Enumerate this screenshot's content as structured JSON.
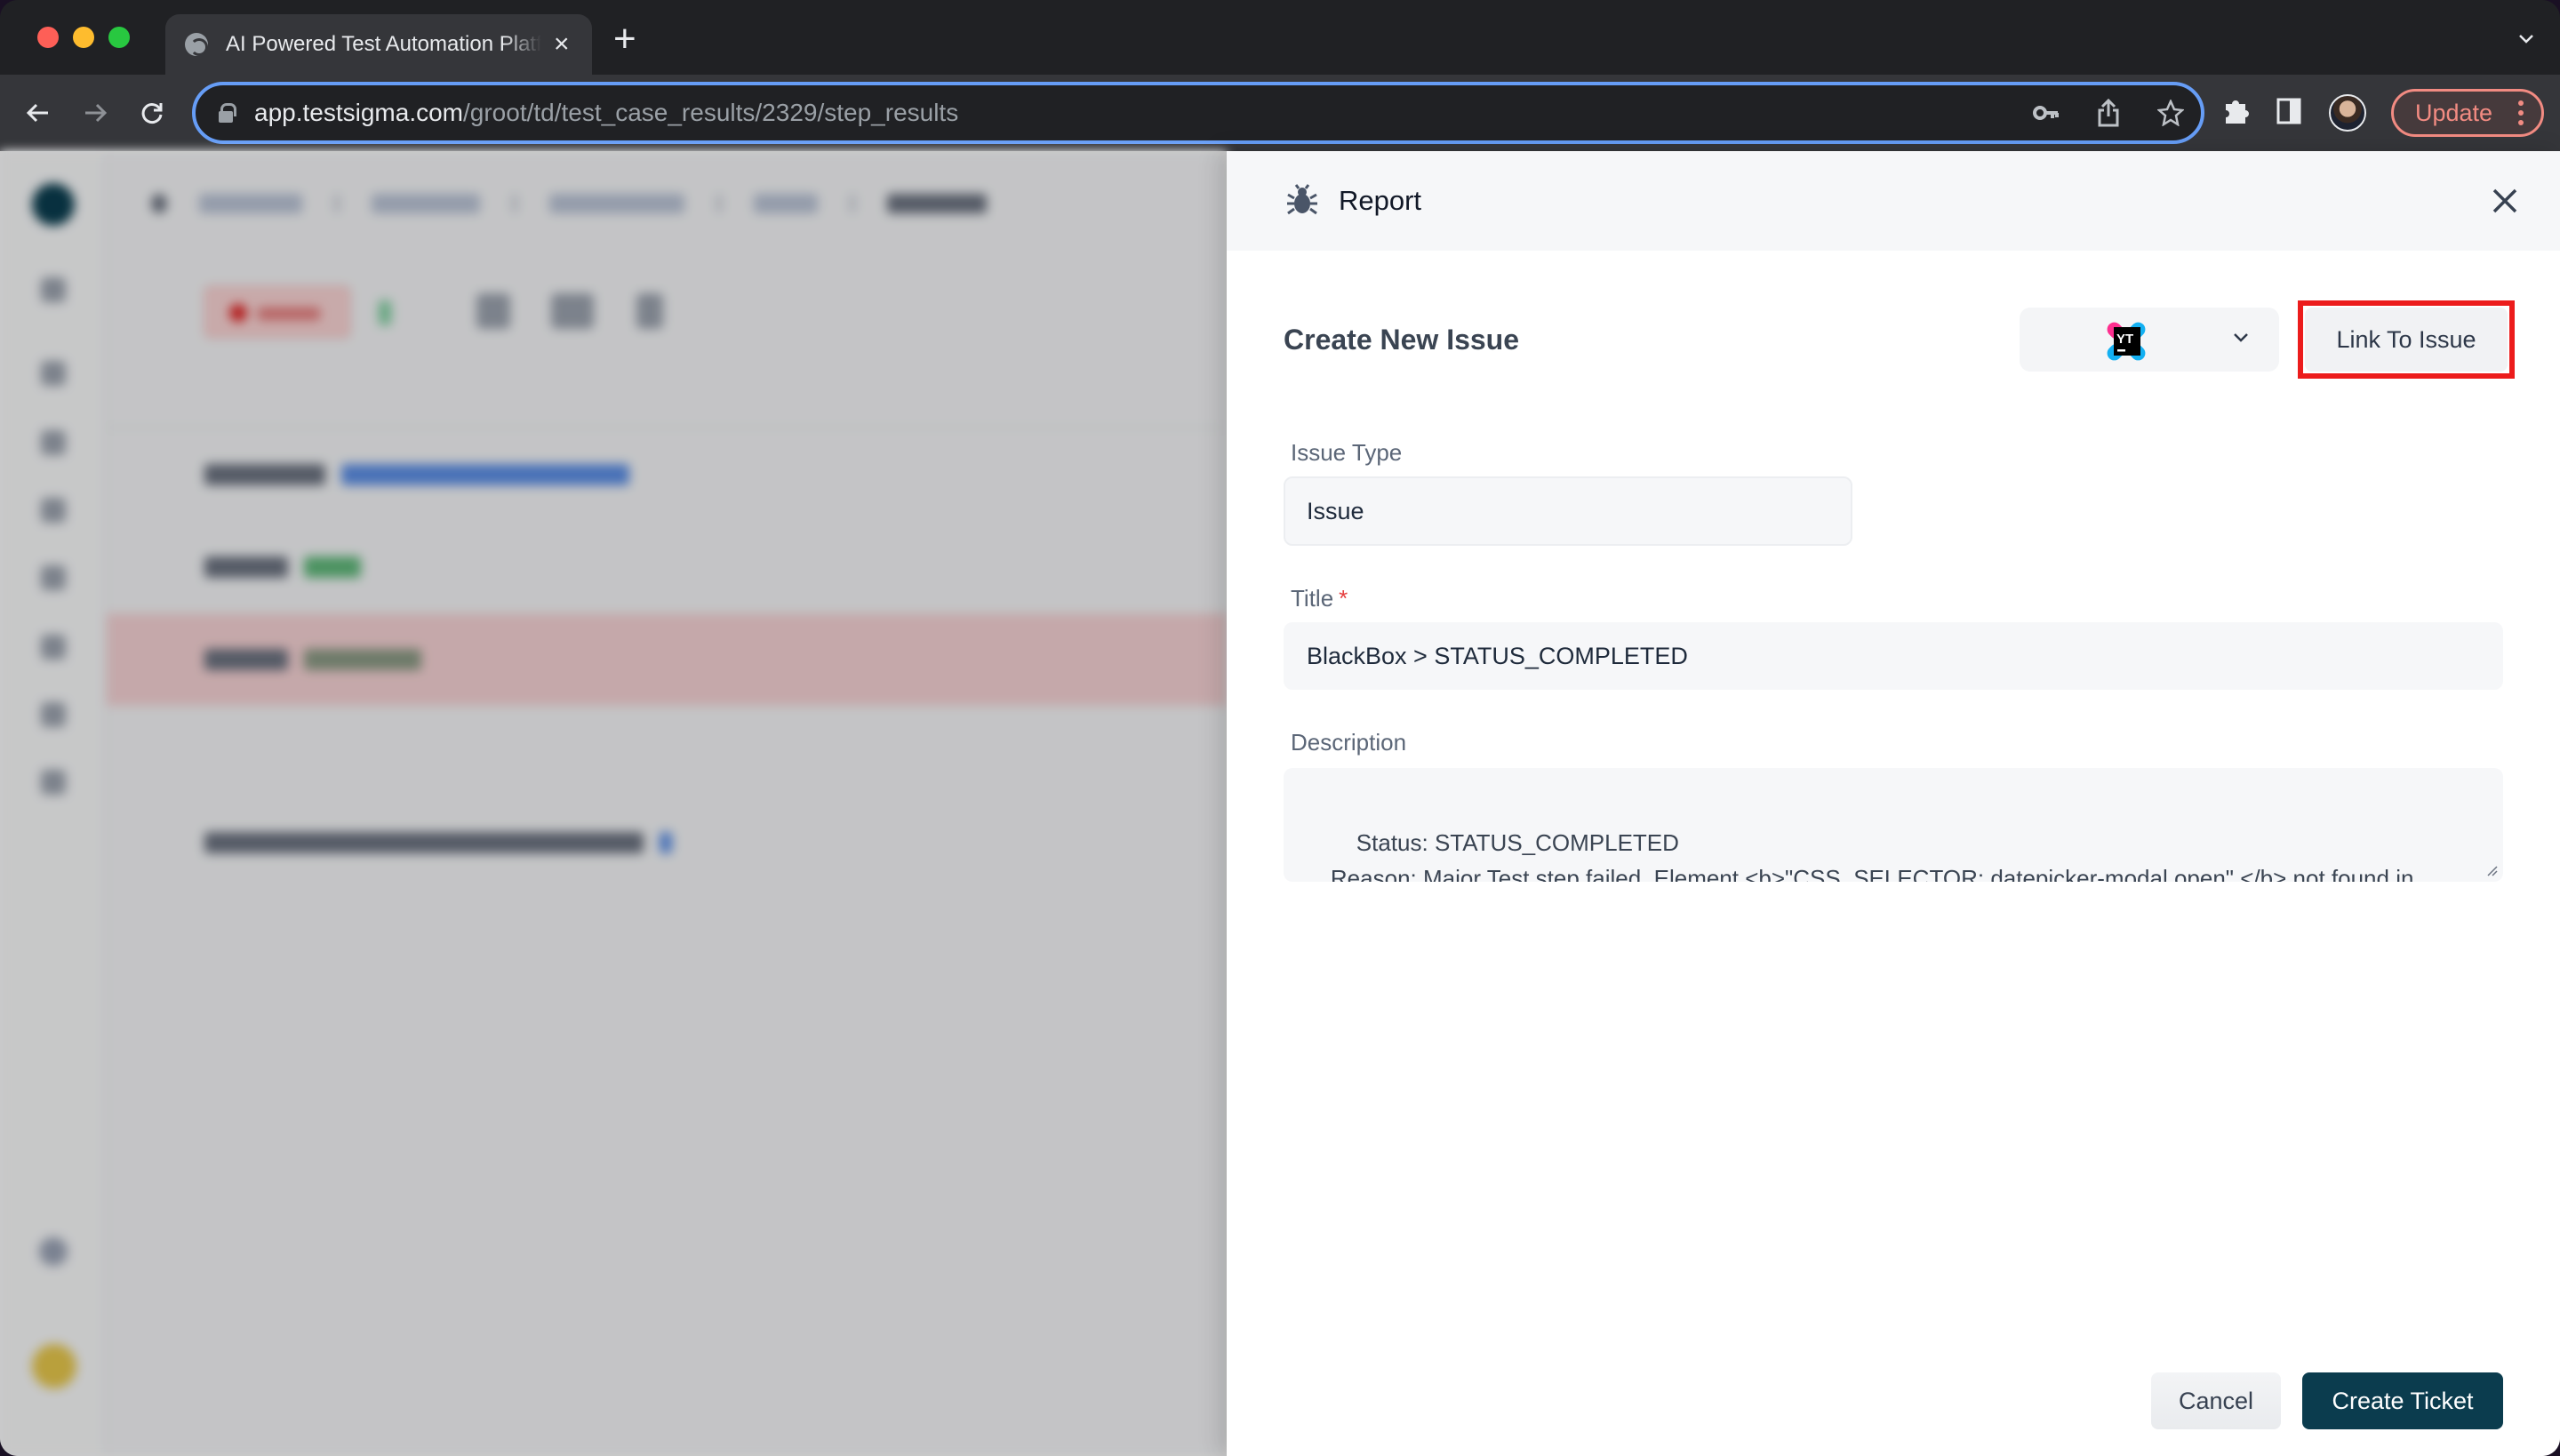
{
  "browser": {
    "tab_title": "AI Powered Test Automation Platform",
    "url_host": "app.testsigma.com",
    "url_path": "/groot/td/test_case_results/2329/step_results",
    "update_label": "Update",
    "icons": {
      "back": "arrow-left-icon",
      "forward": "arrow-right-icon",
      "reload": "reload-icon",
      "password": "key-icon",
      "share": "share-icon",
      "bookmark": "star-icon",
      "extensions": "puzzle-icon",
      "sidepanel": "side-panel-icon",
      "profile": "avatar",
      "menu": "kebab-menu-icon"
    }
  },
  "background_app": {
    "note": "blurred test case step results page behind modal drawer",
    "status_color": "#e02424"
  },
  "drawer": {
    "header_title": "Report",
    "header_icon": "bug-icon",
    "section_title": "Create New Issue",
    "tracker": {
      "selected": "YouTrack",
      "icon": "youtrack-logo-icon"
    },
    "link_to_issue_label": "Link To Issue",
    "fields": {
      "issue_type": {
        "label": "Issue Type",
        "value": "Issue"
      },
      "title": {
        "label": "Title",
        "required_mark": "*",
        "value": "BlackBox > STATUS_COMPLETED"
      },
      "description": {
        "label": "Description",
        "value": "Status: STATUS_COMPLETED\n    Reason: Major Test step failed .Element <b>\"CSS_SELECTOR:.datepicker-modal.open\" </b> not found in current page.<br> Please visit below page for more details<br> <a class=\"text-link\" href ="
      }
    },
    "buttons": {
      "cancel": "Cancel",
      "create": "Create Ticket"
    },
    "colors": {
      "primary": "#0b3c4e",
      "highlight": "#ec1c1c",
      "required": "#e53e3e"
    }
  }
}
